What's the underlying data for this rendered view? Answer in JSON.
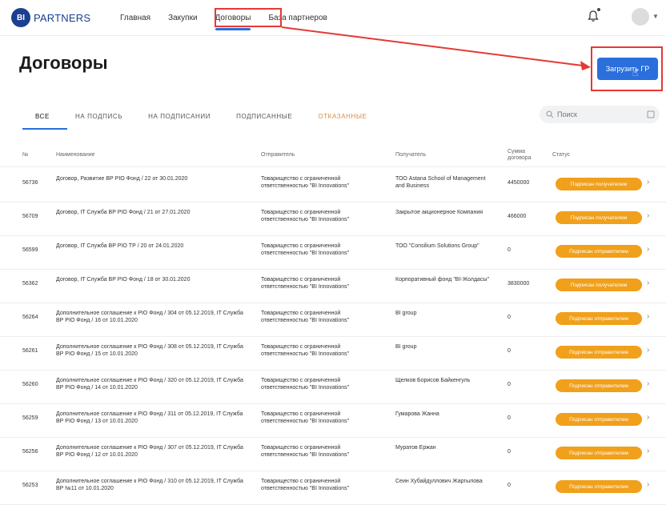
{
  "brand": {
    "badge": "BI",
    "name": "PARTNERS"
  },
  "nav": [
    {
      "label": "Главная"
    },
    {
      "label": "Закупки"
    },
    {
      "label": "Договоры"
    },
    {
      "label": "База партнеров"
    }
  ],
  "page_title": "Договоры",
  "action_button": "Загрузить ГР",
  "tabs": [
    {
      "label": "ВСЕ"
    },
    {
      "label": "НА ПОДПИСЬ"
    },
    {
      "label": "НА ПОДПИСАНИИ"
    },
    {
      "label": "ПОДПИСАННЫЕ"
    },
    {
      "label": "ОТКАЗАННЫЕ"
    }
  ],
  "search_placeholder": "Поиск",
  "columns": [
    "№",
    "Наименование",
    "Отправитель",
    "Получатель",
    "Сумма договора",
    "Статус"
  ],
  "rows": [
    {
      "id": "56736",
      "name": "Договор, Развитие ВР PIO Фонд / 22 от 30.01.2020",
      "sender": "Товарищество с ограниченной ответственностью \"BI Innovations\"",
      "recipient": "ТОО Astana School of Management and Business",
      "amount": "4450000",
      "status": "Подписан получателем"
    },
    {
      "id": "56709",
      "name": "Договор, IT Служба ВР PIO Фонд / 21 от 27.01.2020",
      "sender": "Товарищество с ограниченной ответственностью \"BI Innovations\"",
      "recipient": "Закрытое акционерное Компания",
      "amount": "466000",
      "status": "Подписан получателем"
    },
    {
      "id": "56599",
      "name": "Договор, IT Служба ВР PIO ТР / 20 от 24.01.2020",
      "sender": "Товарищество с ограниченной ответственностью \"BI Innovations\"",
      "recipient": "ТОО \"Consilium Solutions Group\"",
      "amount": "0",
      "status": "Подписан отправителем"
    },
    {
      "id": "56362",
      "name": "Договор, IT Служба ВР PIO Фонд / 18 от 30.01.2020",
      "sender": "Товарищество с ограниченной ответственностью \"BI Innovations\"",
      "recipient": "Корпоративный фонд \"BI-Жолдасы\"",
      "amount": "3830000",
      "status": "Подписан получателем"
    },
    {
      "id": "56264",
      "name": "Дополнительное соглашение к PIO Фонд / 304 от 05.12.2019, IT Служба ВР PIO Фонд / 16 от 10.01.2020",
      "sender": "Товарищество с ограниченной ответственностью \"BI Innovations\"",
      "recipient": "BI group",
      "amount": "0",
      "status": "Подписан отправителем"
    },
    {
      "id": "56261",
      "name": "Дополнительное соглашение к PIO Фонд / 308 от 05.12.2019, IT Служба ВР PIO Фонд / 15 от 10.01.2020",
      "sender": "Товарищество с ограниченной ответственностью \"BI Innovations\"",
      "recipient": "BI group",
      "amount": "0",
      "status": "Подписан отправителем"
    },
    {
      "id": "56260",
      "name": "Дополнительное соглашение к PIO Фонд / 320 от 05.12.2019, IT Служба ВР PIO Фонд / 14 от 10.01.2020",
      "sender": "Товарищество с ограниченной ответственностью \"BI Innovations\"",
      "recipient": "Щелков Борисов Байкенгуль",
      "amount": "0",
      "status": "Подписан отправителем"
    },
    {
      "id": "56259",
      "name": "Дополнительное соглашение к PIO Фонд / 311 от 05.12.2019, IT Служба ВР PIO Фонд / 13 от 10.01.2020",
      "sender": "Товарищество с ограниченной ответственностью \"BI Innovations\"",
      "recipient": "Гумарова Жанна",
      "amount": "0",
      "status": "Подписан отправителем"
    },
    {
      "id": "56256",
      "name": "Дополнительное соглашение к PIO Фонд / 307 от 05.12.2019, IT Служба ВР PIO Фонд / 12 от 10.01.2020",
      "sender": "Товарищество с ограниченной ответственностью \"BI Innovations\"",
      "recipient": "Муратов Ержан",
      "amount": "0",
      "status": "Подписан отправителем"
    },
    {
      "id": "56253",
      "name": "Дополнительное соглашение к PIO Фонд / 310 от 05.12.2019, IT Служба ВР №11 от 10.01.2020",
      "sender": "Товарищество с ограниченной ответственностью \"BI Innovations\"",
      "recipient": "Сеин Хубайдуллович Жаргылова",
      "amount": "0",
      "status": "Подписан отправителем"
    }
  ],
  "colors": {
    "accent": "#2a6fdb",
    "status": "#f0a01b",
    "annotation": "#e53935",
    "brand": "#1d3f8f"
  }
}
